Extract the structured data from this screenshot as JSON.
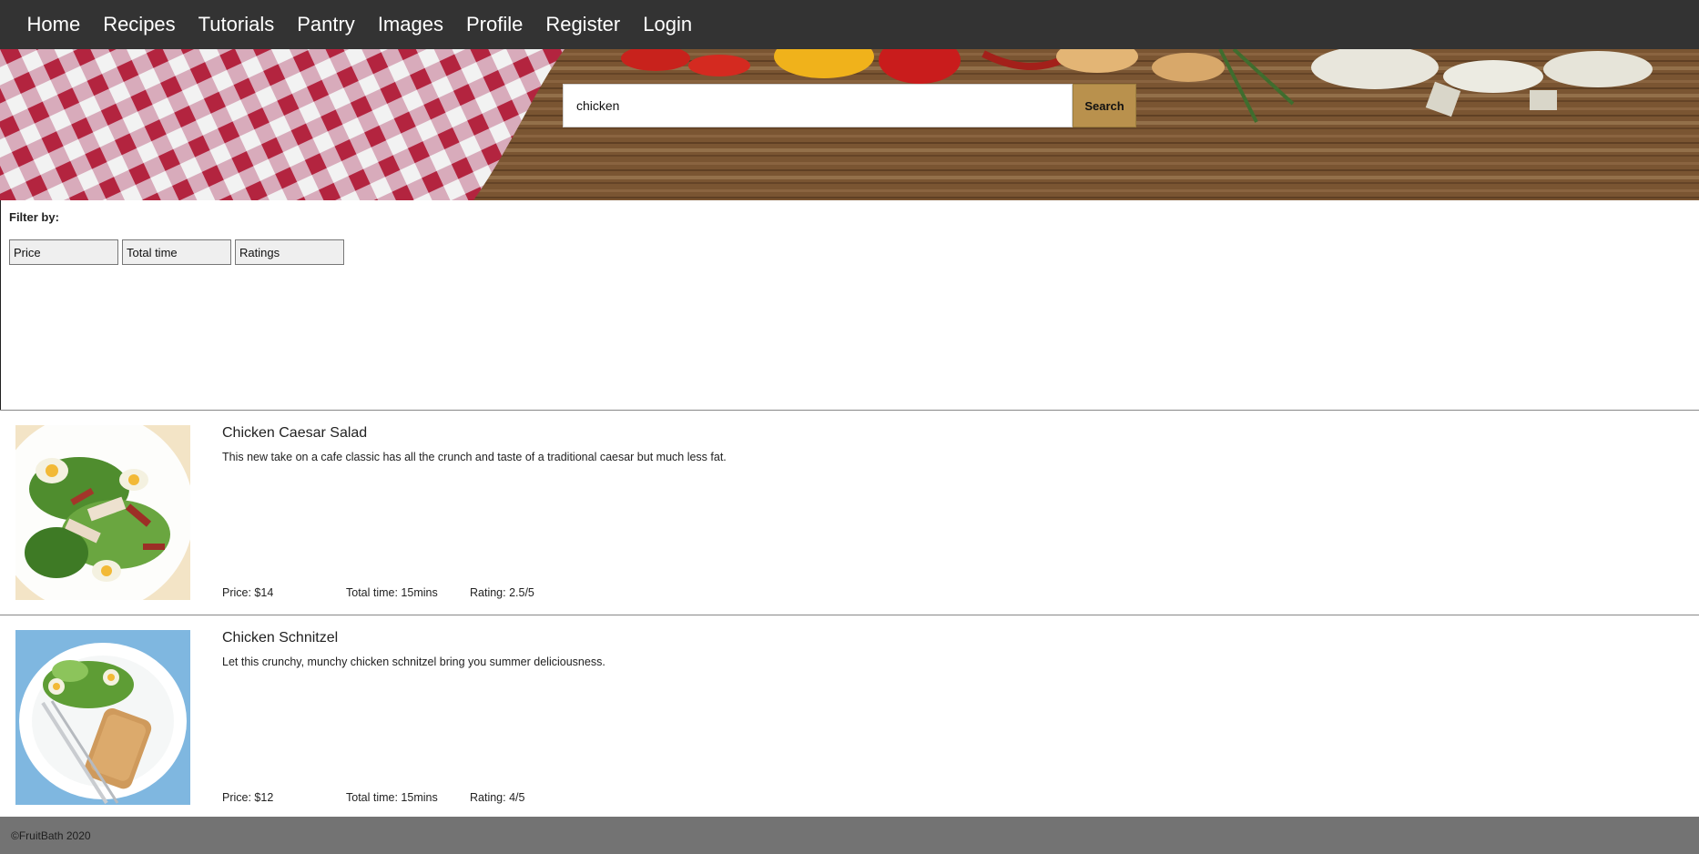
{
  "nav": {
    "items": [
      {
        "label": "Home"
      },
      {
        "label": "Recipes"
      },
      {
        "label": "Tutorials"
      },
      {
        "label": "Pantry"
      },
      {
        "label": "Images"
      },
      {
        "label": "Profile"
      },
      {
        "label": "Register"
      },
      {
        "label": "Login"
      }
    ]
  },
  "search": {
    "value": "chicken",
    "button_label": "Search"
  },
  "filter": {
    "label": "Filter by:",
    "buttons": [
      {
        "label": "Price"
      },
      {
        "label": "Total time"
      },
      {
        "label": "Ratings"
      }
    ]
  },
  "recipes": [
    {
      "title": "Chicken Caesar Salad",
      "description": "This new take on a cafe classic has all the crunch and taste of a traditional caesar but much less fat.",
      "price": "Price: $14",
      "time": "Total time: 15mins",
      "rating": "Rating: 2.5/5"
    },
    {
      "title": "Chicken Schnitzel",
      "description": "Let this crunchy, munchy chicken schnitzel bring you summer deliciousness.",
      "price": "Price: $12",
      "time": "Total time: 15mins",
      "rating": "Rating: 4/5"
    }
  ],
  "footer": {
    "text": "©FruitBath 2020"
  },
  "colors": {
    "nav_bg": "#333333",
    "search_button": "#b9914d",
    "footer_bg": "#737373"
  }
}
